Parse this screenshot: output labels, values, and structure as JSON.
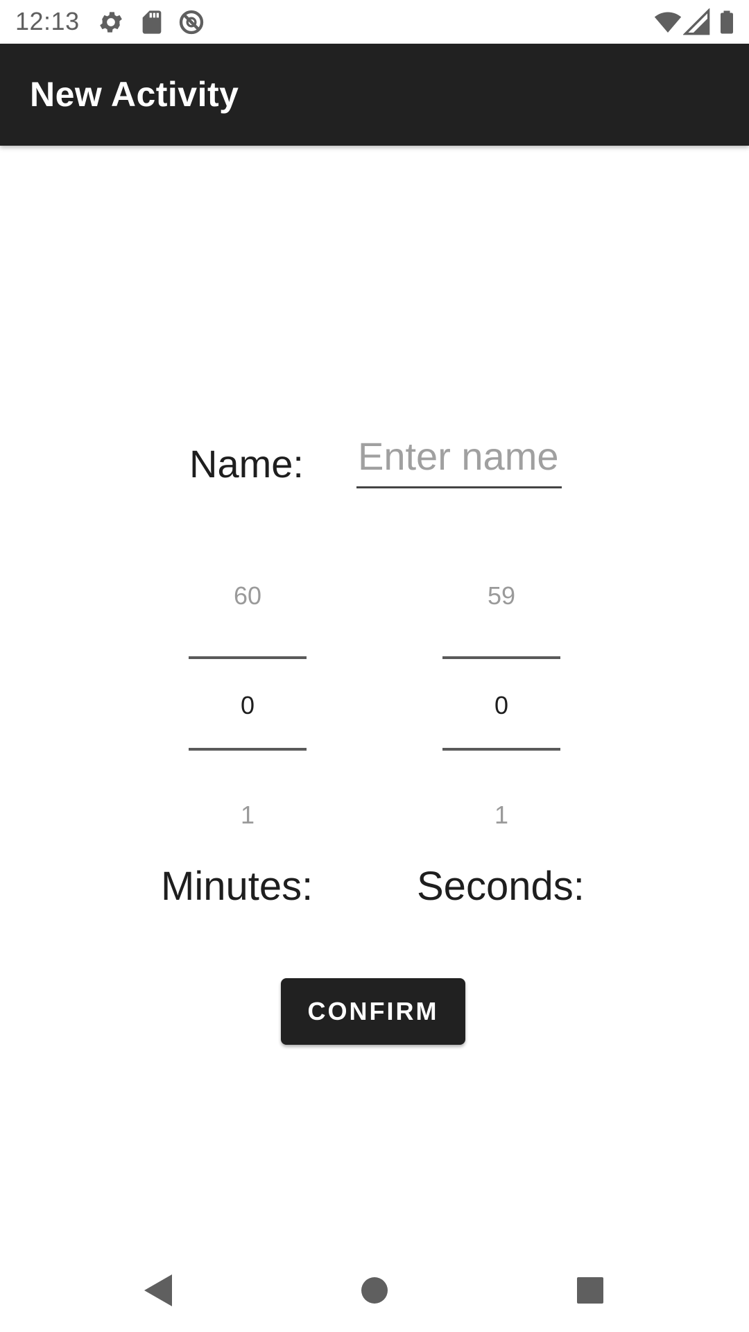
{
  "status_bar": {
    "time": "12:13",
    "left_icons": [
      "settings-icon",
      "sd-card-icon",
      "do-not-disturb-icon"
    ],
    "right_icons": [
      "wifi-icon",
      "cell-signal-icon",
      "battery-icon"
    ]
  },
  "app_bar": {
    "title": "New Activity",
    "background": "#212121"
  },
  "form": {
    "name_label": "Name:",
    "name_value": "",
    "name_placeholder": "Enter name",
    "minutes_picker": {
      "prev": "60",
      "current": "0",
      "next": "1"
    },
    "seconds_picker": {
      "prev": "59",
      "current": "0",
      "next": "1"
    },
    "minutes_label": "Minutes:",
    "seconds_label": "Seconds:",
    "confirm_label": "CONFIRM"
  },
  "nav_bar": {
    "buttons": [
      "back-icon",
      "home-icon",
      "recents-icon"
    ]
  }
}
